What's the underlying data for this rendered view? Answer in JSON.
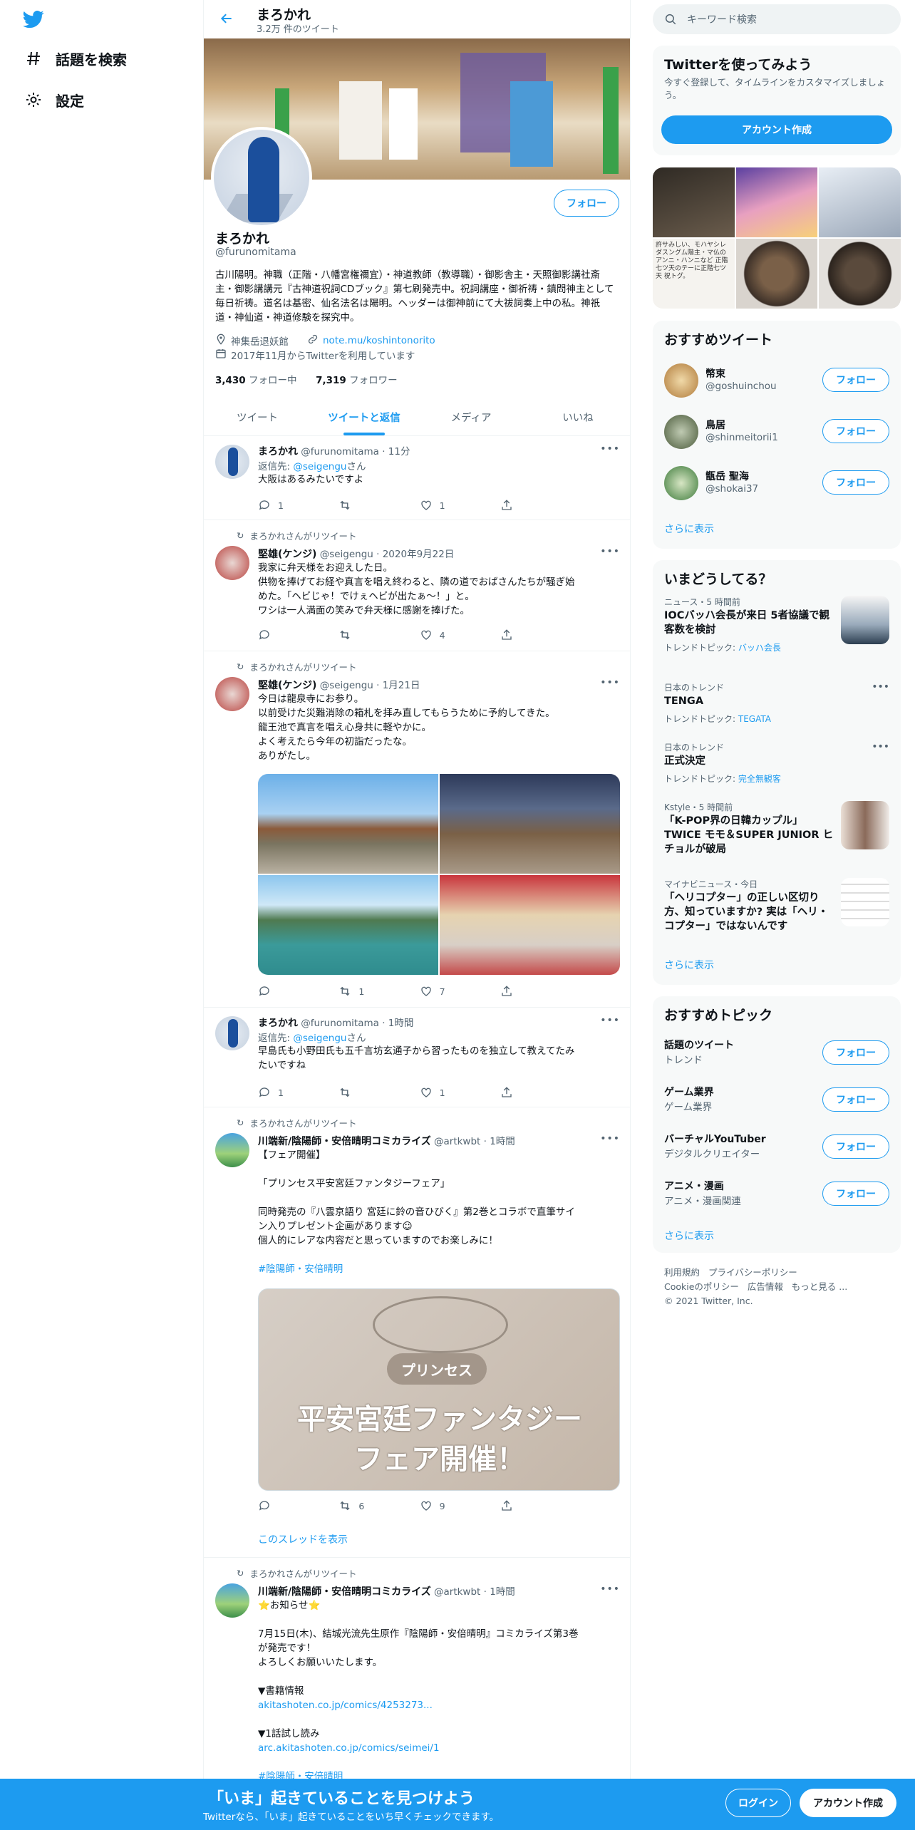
{
  "nav": {
    "explore": "話題を検索",
    "settings": "設定"
  },
  "header": {
    "title": "まろかれ",
    "subtitle": "3.2万 件のツイート"
  },
  "profile": {
    "name": "まろかれ",
    "handle": "@furunomitama",
    "follow": "フォロー",
    "bio": "古川陽明。神職（正階・八幡宮権禰宜）・神道教師（教導職）・御影舎主・天照御影講社斎主・御影講講元『古神道祝詞CDブック』第七刷発売中。祝詞講座・御祈祷・鎮問神主として毎日祈祷。道名は基密、仙名法名は陽明。ヘッダーは御神前にて大祓詞奏上中の私。神祇道・神仙道・神道修験を探究中。",
    "location": "神集岳退妖館",
    "url": "note.mu/koshintonorito",
    "joined": "2017年11月からTwitterを利用しています",
    "following_count": "3,430",
    "following_label": "フォロー中",
    "followers_count": "7,319",
    "followers_label": "フォロワー"
  },
  "tabs": [
    "ツイート",
    "ツイートと返信",
    "メディア",
    "いいね"
  ],
  "tweets": [
    {
      "name": "まろかれ",
      "handle": "@furunomitama",
      "time": "11分",
      "reply_to_prefix": "返信先: ",
      "reply_to": "@seigengu",
      "reply_suffix": "さん",
      "text": "大阪はあるみたいですよ",
      "replies": "1",
      "retweets": "",
      "likes": "1"
    },
    {
      "retweeted_by": "まろかれさんがリツイート",
      "name": "堅雄(ケンジ)",
      "handle": "@seigengu",
      "time": "2020年9月22日",
      "lines": [
        "我家に弁天様をお迎えした日。",
        "供物を捧げてお経や真言を唱え終わると、隣の道でおばさんたちが騒ぎ始",
        "めた。「ヘビじゃ！でけぇヘビが出たぁ〜！」と。",
        "ワシは一人満面の笑みで弁天様に感謝を捧げた。"
      ],
      "replies": "",
      "retweets": "",
      "likes": "4"
    },
    {
      "retweeted_by": "まろかれさんがリツイート",
      "name": "堅雄(ケンジ)",
      "handle": "@seigengu",
      "time": "1月21日",
      "lines": [
        "今日は龍泉寺にお参り。",
        "以前受けた災難消除の箱札を拝み直してもらうために予約してきた。",
        "龍王池で真言を唱え心身共に軽やかに。",
        "よく考えたら今年の初詣だったな。",
        "ありがたし。"
      ],
      "replies": "",
      "retweets": "1",
      "likes": "7"
    },
    {
      "name": "まろかれ",
      "handle": "@furunomitama",
      "time": "1時間",
      "reply_to_prefix": "返信先: ",
      "reply_to": "@seigengu",
      "reply_suffix": "さん",
      "lines": [
        "早島氏も小野田氏も五千言坊玄通子から習ったものを独立して教えてたみ",
        "たいですね"
      ],
      "replies": "1",
      "retweets": "",
      "likes": "1"
    },
    {
      "retweeted_by": "まろかれさんがリツイート",
      "name": "川端新/陰陽師・安倍晴明コミカライズ",
      "handle": "@artkwbt",
      "time": "1時間",
      "lines": [
        "【フェア開催】",
        "",
        "「プリンセス平安宮廷ファンタジーフェア」",
        "",
        "同時発売の『八雲京語り 宮廷に鈴の音ひびく』第2巻とコラボで直筆サイ",
        "ン入りプレゼント企画があります☺",
        "個人的にレアな内容だと思っていますのでお楽しみに！"
      ],
      "hashtag": "#陰陽師・安倍晴明",
      "promo_pill": "プリンセス",
      "promo_line1": "平安宮廷ファンタジー",
      "promo_line2": "フェア開催！",
      "replies": "",
      "retweets": "6",
      "likes": "9",
      "thread": "このスレッドを表示"
    },
    {
      "retweeted_by": "まろかれさんがリツイート",
      "name": "川端新/陰陽師・安倍晴明コミカライズ",
      "handle": "@artkwbt",
      "time": "1時間",
      "lines": [
        "⭐お知らせ⭐",
        "",
        "7月15日(木)、結城光流先生原作『陰陽師・安倍晴明』コミカライズ第3巻",
        "が発売です！",
        "よろしくお願いいたします。",
        "",
        "▼書籍情報"
      ],
      "link1": "akitashoten.co.jp/comics/4253273...",
      "label2": "▼1話試し読み",
      "link2": "arc.akitashoten.co.jp/comics/seimei/1",
      "hashtag": "#陰陽師・安倍晴明"
    }
  ],
  "sidebar": {
    "search_placeholder": "キーワード検索",
    "signup": {
      "title": "Twitterを使ってみよう",
      "text": "今すぐ登録して、タイムラインをカスタマイズしましょう。",
      "button": "アカウント作成"
    },
    "media_caption": "許サみしい、モハヤシレダスングム階主・マ仏のアンニ・ハンニなど 正階七ツ天のテーに正階七ツ天 祝トグ。",
    "who_title": "おすすめツイート",
    "who": [
      {
        "name": "幣束",
        "handle": "@goshuinchou"
      },
      {
        "name": "鳥居",
        "handle": "@shinmeitorii1"
      },
      {
        "name": "甑岳 聖海",
        "handle": "@shokai37"
      }
    ],
    "show_more": "さらに表示",
    "trends_title": "いまどうしてる？",
    "trends": [
      {
        "meta": "ニュース・5 時間前",
        "title": "IOCバッハ会長が来日 5者協議で観客数を検討",
        "topic_prefix": "トレンドトピック: ",
        "topic": "バッハ会長"
      },
      {
        "meta": "日本のトレンド",
        "title": "TENGA",
        "topic_prefix": "トレンドトピック: ",
        "topic": "TEGATA"
      },
      {
        "meta": "日本のトレンド",
        "title": "正式決定",
        "topic_prefix": "トレンドトピック: ",
        "topic": "完全無観客"
      },
      {
        "meta": "Kstyle・5 時間前",
        "title": "「K-POP界の日韓カップル」TWICE モモ＆SUPER JUNIOR ヒチョルが破局"
      },
      {
        "meta": "マイナビニュース・今日",
        "title": "「ヘリコプター」の正しい区切り方、知っていますか? 実は「ヘリ・コプター」ではないんです"
      }
    ],
    "topics_title": "おすすめトピック",
    "topics": [
      {
        "name": "話題のツイート",
        "cat": "トレンド"
      },
      {
        "name": "ゲーム業界",
        "cat": "ゲーム業界"
      },
      {
        "name": "バーチャルYouTuber",
        "cat": "デジタルクリエイター"
      },
      {
        "name": "アニメ・漫画",
        "cat": "アニメ・漫画関連"
      }
    ],
    "footer": [
      "利用規約",
      "プライバシーポリシー",
      "Cookieのポリシー",
      "広告情報",
      "もっと見る ...",
      "© 2021 Twitter, Inc."
    ]
  },
  "bottom": {
    "headline": "「いま」起きていることを見つけよう",
    "sub": "Twitterなら、「いま」起きていることをいち早くチェックできます。",
    "login": "ログイン",
    "signup": "アカウント作成"
  },
  "colors": {
    "accent": "#1d9bf0",
    "text": "#0f1419",
    "muted": "#536471"
  }
}
